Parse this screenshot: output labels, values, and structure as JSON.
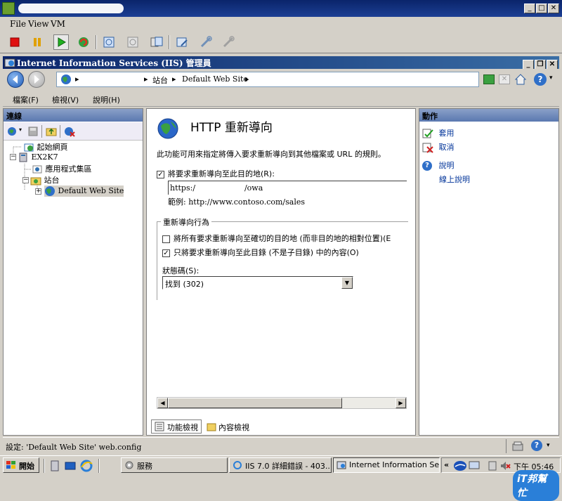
{
  "vm": {
    "menu": [
      "File",
      "View",
      "VM"
    ]
  },
  "iis": {
    "title": "Internet Information Services (IIS) 管理員",
    "address": {
      "crumbs": [
        "站台",
        "Default Web Site"
      ]
    },
    "menu": [
      "檔案(F)",
      "檢視(V)",
      "說明(H)"
    ]
  },
  "connections": {
    "header": "連線",
    "tree": {
      "start_page": "起始網頁",
      "server": "EX2K7",
      "app_pools": "應用程式集區",
      "sites": "站台",
      "default_site": "Default Web Site"
    }
  },
  "feature": {
    "title": "HTTP 重新導向",
    "description": "此功能可用來指定將傳入要求重新導向到其他檔案或 URL 的規則。",
    "redirect_checkbox_label": "將要求重新導向至此目的地(R):",
    "redirect_checked": true,
    "destination_value": "https:/                    /owa",
    "example": "範例: http://www.contoso.com/sales",
    "behavior_group": "重新導向行為",
    "exact_dest_label": "將所有要求重新導向至確切的目的地 (而非目的地的相對位置)(E",
    "exact_dest_checked": false,
    "only_dir_label": "只將要求重新導向至此目錄 (不是子目錄) 中的內容(O)",
    "only_dir_checked": true,
    "status_code_label": "狀態碼(S):",
    "status_code_value": "找到 (302)"
  },
  "view_tabs": {
    "features": "功能檢視",
    "content": "內容檢視"
  },
  "actions": {
    "header": "動作",
    "apply": "套用",
    "cancel": "取消",
    "help": "說明",
    "online_help": "線上說明"
  },
  "status_bar": {
    "text": "設定: 'Default Web Site' web.config"
  },
  "taskbar": {
    "start": "開始",
    "buttons": [
      "服務",
      "IIS 7.0 詳細錯誤 - 403....",
      "Internet Information Ser..."
    ],
    "clock": "下午 05:46",
    "brand": "iT邦幫忙"
  },
  "colors": {
    "title_bar": "#0a246a",
    "panel_header": "#6b86bb",
    "face": "#d4d0c8"
  }
}
